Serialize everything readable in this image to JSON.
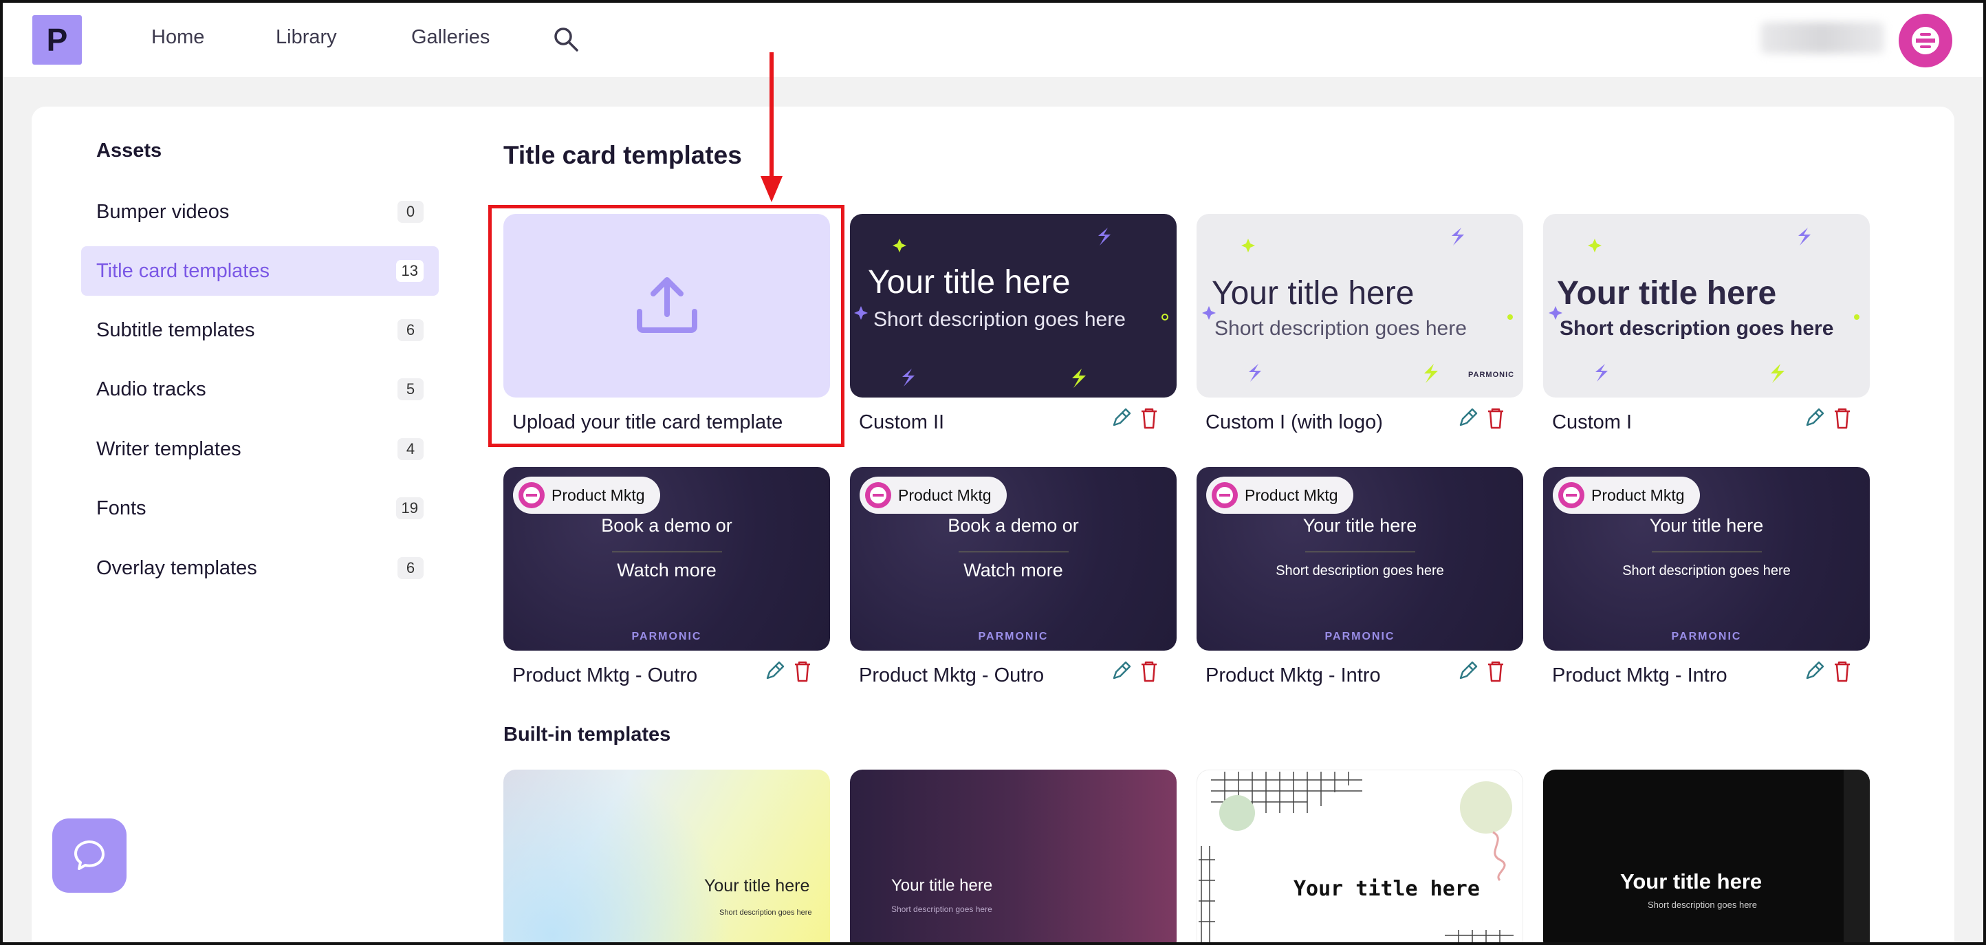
{
  "nav": {
    "home": "Home",
    "library": "Library",
    "galleries": "Galleries",
    "logo_letter": "P"
  },
  "sidebar": {
    "heading": "Assets",
    "items": [
      {
        "label": "Bumper videos",
        "count": "0"
      },
      {
        "label": "Title card templates",
        "count": "13",
        "active": true
      },
      {
        "label": "Subtitle templates",
        "count": "6"
      },
      {
        "label": "Audio tracks",
        "count": "5"
      },
      {
        "label": "Writer templates",
        "count": "4"
      },
      {
        "label": "Fonts",
        "count": "19"
      },
      {
        "label": "Overlay templates",
        "count": "6"
      }
    ]
  },
  "main": {
    "heading": "Title card templates",
    "builtin_heading": "Built-in templates",
    "upload_label": "Upload your title card template",
    "custom_cards": [
      {
        "name": "Custom II",
        "title": "Your title here",
        "desc": "Short description goes here"
      },
      {
        "name": "Custom I (with logo)",
        "title": "Your title here",
        "desc": "Short description goes here",
        "brand": "PARMONIC"
      },
      {
        "name": "Custom I",
        "title": "Your title here",
        "desc": "Short description goes here"
      }
    ],
    "product_cards": [
      {
        "name": "Product Mktg - Outro",
        "badge": "Product Mktg",
        "line1": "Book a demo or",
        "line2": "Watch more",
        "brand": "PARMONIC"
      },
      {
        "name": "Product Mktg - Outro",
        "badge": "Product Mktg",
        "line1": "Book a demo or",
        "line2": "Watch more",
        "brand": "PARMONIC"
      },
      {
        "name": "Product Mktg - Intro",
        "badge": "Product Mktg",
        "line1": "Your title here",
        "line2": "Short description goes here",
        "brand": "PARMONIC"
      },
      {
        "name": "Product Mktg - Intro",
        "badge": "Product Mktg",
        "line1": "Your title here",
        "line2": "Short description goes here",
        "brand": "PARMONIC"
      }
    ],
    "builtin_cards": [
      {
        "title": "Your title here",
        "desc": "Short description goes here"
      },
      {
        "title": "Your title here",
        "desc": "Short description goes here"
      },
      {
        "title": "Your title here"
      },
      {
        "title": "Your title here",
        "desc": "Short description goes here"
      }
    ]
  },
  "colors": {
    "accent": "#a593f5",
    "highlight": "#e8161b",
    "avatar": "#d93ca6",
    "active_bg": "#e6e2fd"
  }
}
